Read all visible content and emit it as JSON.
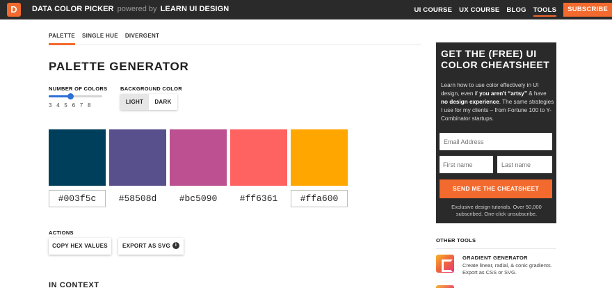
{
  "app": {
    "logo_letter": "D",
    "name": "DATA COLOR PICKER",
    "powered_by": "powered by",
    "powered_brand": "LEARN UI DESIGN",
    "accent": "#f26a2e"
  },
  "nav": {
    "items": [
      {
        "label": "UI COURSE"
      },
      {
        "label": "UX COURSE"
      },
      {
        "label": "BLOG"
      },
      {
        "label": "TOOLS"
      }
    ],
    "subscribe": "SUBSCRIBE"
  },
  "tabs": [
    {
      "label": "PALETTE"
    },
    {
      "label": "SINGLE HUE"
    },
    {
      "label": "DIVERGENT"
    }
  ],
  "page_title": "PALETTE GENERATOR",
  "number_of_colors": {
    "label": "NUMBER OF COLORS",
    "options": [
      "3",
      "4",
      "5",
      "6",
      "7",
      "8"
    ],
    "value": 5
  },
  "background_color": {
    "label": "BACKGROUND COLOR",
    "options": [
      "LIGHT",
      "DARK"
    ],
    "selected": "LIGHT"
  },
  "palette": [
    {
      "color": "#003f5c",
      "hex": "#003f5c"
    },
    {
      "color": "#58508d",
      "hex": "#58508d"
    },
    {
      "color": "#bc5090",
      "hex": "#bc5090"
    },
    {
      "color": "#ff6361",
      "hex": "#ff6361"
    },
    {
      "color": "#ffa600",
      "hex": "#ffa600"
    }
  ],
  "actions": {
    "label": "ACTIONS",
    "copy": "COPY HEX VALUES",
    "export": "EXPORT AS SVG"
  },
  "in_context": "IN CONTEXT",
  "cta": {
    "title_line1": "GET THE (FREE)",
    "title_line2": "UI",
    "title_line3": "COLOR CHEATSHEET",
    "body_1": "Learn how to use color effectively in UI design, even if ",
    "body_2": "you aren't “artsy”",
    "body_3": " & have ",
    "body_4": "no design experience",
    "body_5": ". The same strategies I use for my clients – from Fortune 100 to Y-Combinator startups.",
    "email_placeholder": "Email Address",
    "first_placeholder": "First name",
    "last_placeholder": "Last name",
    "button": "SEND ME THE CHEATSHEET",
    "footer": "Exclusive design tutorials. Over 50,000 subscribed. One-click unsubscribe."
  },
  "other_tools": {
    "label": "OTHER TOOLS",
    "items": [
      {
        "title": "GRADIENT GENERATOR",
        "desc": "Create linear, radial, & conic gradients. Export as CSS or SVG."
      }
    ]
  }
}
